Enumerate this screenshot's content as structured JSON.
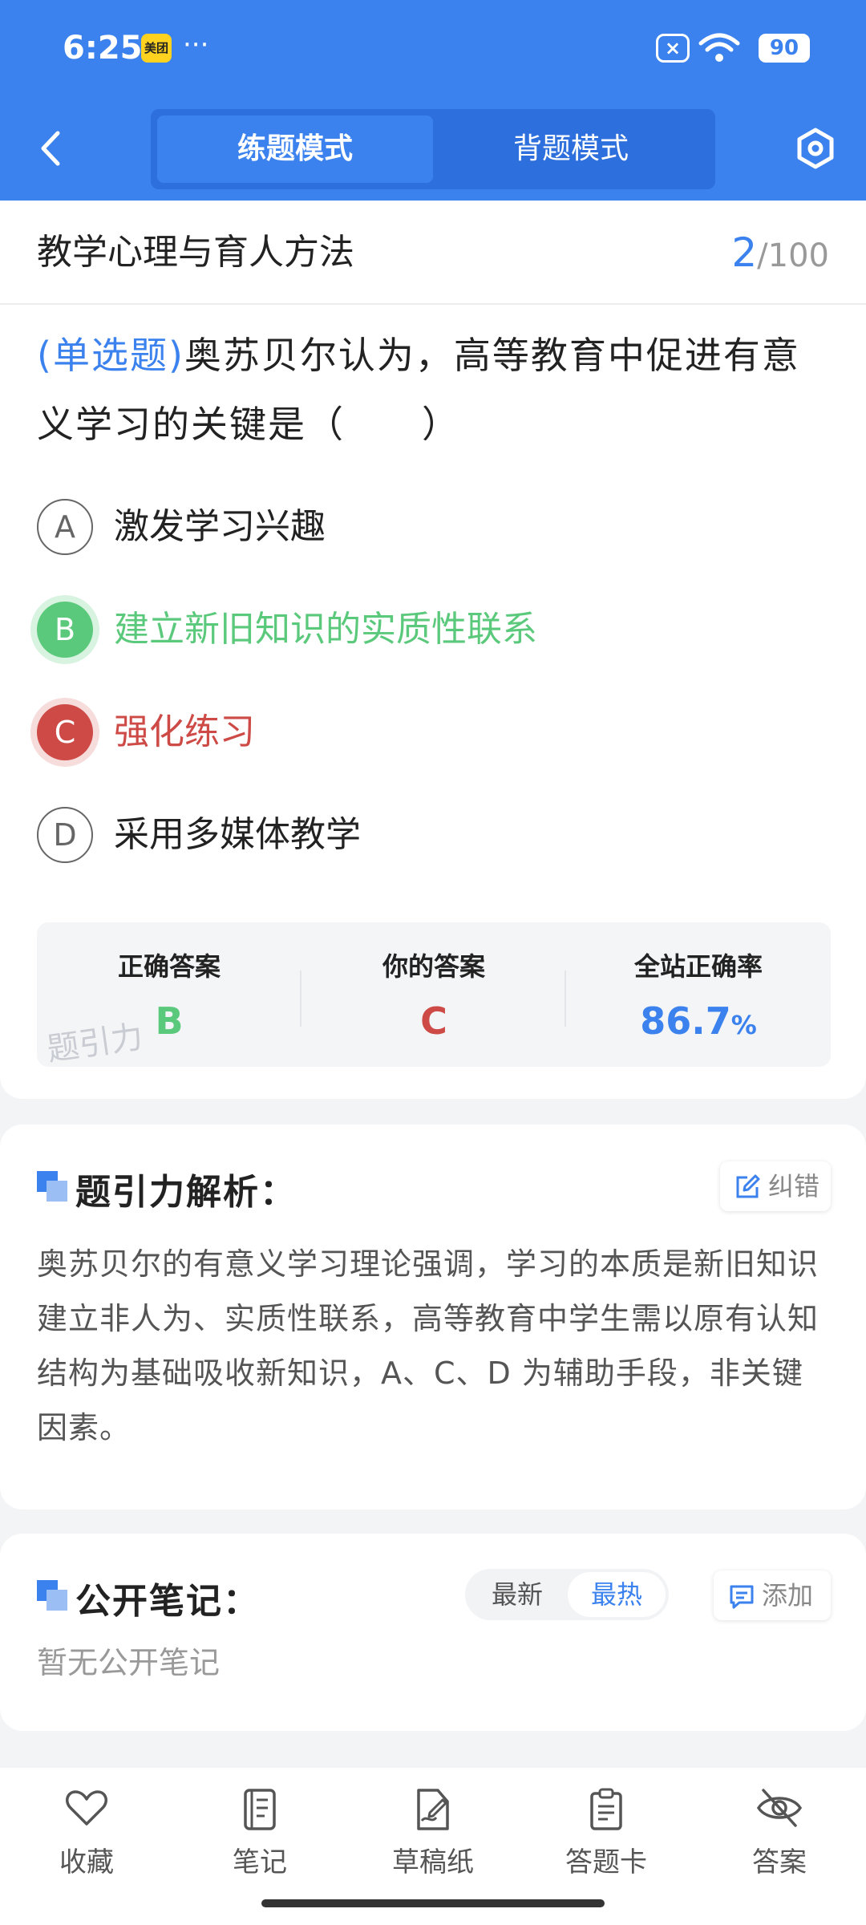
{
  "status_bar": {
    "time": "6:25",
    "app_badge": "美团",
    "dots": "···",
    "battery": "90"
  },
  "header": {
    "modes": [
      "练题模式",
      "背题模式"
    ],
    "active_mode": "练题模式"
  },
  "question_card": {
    "subject": "教学心理与育人方法",
    "progress": {
      "current": "2",
      "total": "/100"
    },
    "question_type": "(单选题)",
    "question_text": "奥苏贝尔认为，高等教育中促进有意义学习的关键是（　　）",
    "options": [
      {
        "letter": "A",
        "text": "激发学习兴趣",
        "state": "normal"
      },
      {
        "letter": "B",
        "text": "建立新旧知识的实质性联系",
        "state": "correct"
      },
      {
        "letter": "C",
        "text": "强化练习",
        "state": "wrong"
      },
      {
        "letter": "D",
        "text": "采用多媒体教学",
        "state": "normal"
      }
    ],
    "answer_summary": {
      "correct_label": "正确答案",
      "correct_value": "B",
      "yours_label": "你的答案",
      "yours_value": "C",
      "rate_label": "全站正确率",
      "rate_value": "86.7",
      "rate_unit": "%",
      "watermark": "题引力"
    }
  },
  "analysis": {
    "title": "题引力解析：",
    "report_label": "纠错",
    "text": "奥苏贝尔的有意义学习理论强调，学习的本质是新旧知识建立非人为、实质性联系，高等教育中学生需以原有认知结构为基础吸收新知识，A、C、D 为辅助手段，非关键因素。"
  },
  "notes": {
    "title": "公开笔记：",
    "sort_options": [
      "最新",
      "最热"
    ],
    "active_sort": "最热",
    "add_label": "添加",
    "empty_text": "暂无公开笔记"
  },
  "bottom_nav": [
    {
      "label": "收藏",
      "icon": "heart-icon"
    },
    {
      "label": "笔记",
      "icon": "notebook-icon"
    },
    {
      "label": "草稿纸",
      "icon": "draft-pen-icon"
    },
    {
      "label": "答题卡",
      "icon": "clipboard-icon"
    },
    {
      "label": "答案",
      "icon": "eye-off-icon"
    }
  ],
  "colors": {
    "brand": "#3b82ee",
    "correct": "#5bc97b",
    "wrong": "#cd4a46"
  }
}
